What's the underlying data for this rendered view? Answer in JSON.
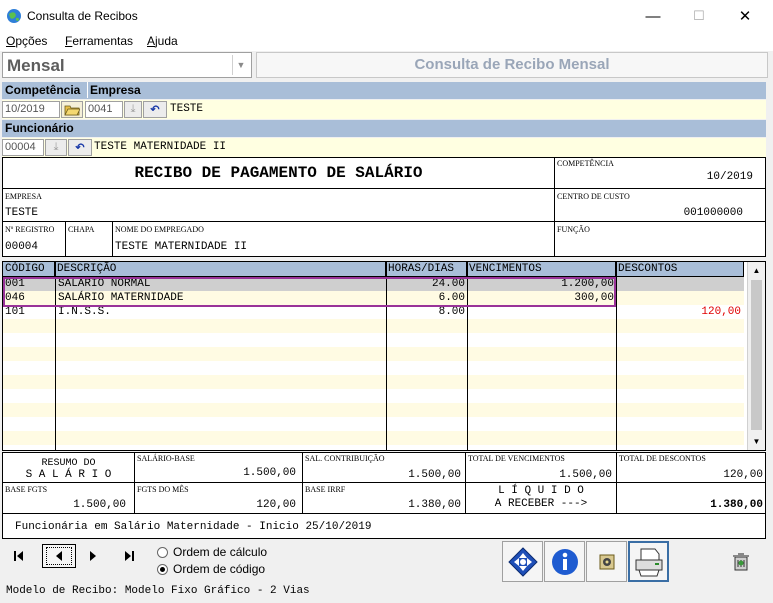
{
  "window": {
    "title": "Consulta de Recibos",
    "min": "—",
    "max": "☐",
    "close": "✕"
  },
  "menu": [
    {
      "label": "Opções",
      "u": "O"
    },
    {
      "label": "Ferramentas",
      "u": "F"
    },
    {
      "label": "Ajuda",
      "u": "A"
    }
  ],
  "combo": {
    "value": "Mensal"
  },
  "header_title": "Consulta de Recibo Mensal",
  "bar1": {
    "competencia": "Competência",
    "empresa": "Empresa"
  },
  "competencia_value": "10/2019",
  "empresa_code": "0041",
  "empresa_name": "TESTE",
  "bar2": {
    "funcionario": "Funcionário"
  },
  "funcionario_code": "00004",
  "funcionario_name": "TESTE MATERNIDADE II",
  "receipt": {
    "title": "RECIBO DE PAGAMENTO DE SALÁRIO",
    "competencia_label": "COMPETÊNCIA",
    "competencia_value": "10/2019",
    "empresa_label": "EMPRESA",
    "empresa_value": "TESTE",
    "centro_label": "CENTRO DE CUSTO",
    "centro_value": "001000000",
    "registro_label": "Nº REGISTRO",
    "registro_value": "00004",
    "chapa_label": "CHAPA",
    "nome_label": "NOME DO EMPREGADO",
    "nome_value": "TESTE MATERNIDADE II",
    "funcao_label": "FUNÇÃO"
  },
  "grid": {
    "headers": [
      "CÓDIGO",
      "DESCRIÇÃO",
      "HORAS/DIAS",
      "VENCIMENTOS",
      "DESCONTOS"
    ],
    "rows": [
      {
        "codigo": "001",
        "descricao": "SALÁRIO NORMAL",
        "horas": "24.00",
        "vencimentos": "1.200,00",
        "descontos": ""
      },
      {
        "codigo": "046",
        "descricao": "SALÁRIO MATERNIDADE",
        "horas": "6.00",
        "vencimentos": "300,00",
        "descontos": ""
      },
      {
        "codigo": "101",
        "descricao": "I.N.S.S.",
        "horas": "8.00",
        "vencimentos": "",
        "descontos": "120,00"
      }
    ]
  },
  "summary": {
    "resumo1": "RESUMO DO",
    "resumo2": "S A L Á R I O",
    "salario_base_label": "SALÁRIO-BASE",
    "salario_base_value": "1.500,00",
    "sal_contrib_label": "SAL. CONTRIBUIÇÃO",
    "sal_contrib_value": "1.500,00",
    "total_venc_label": "TOTAL DE VENCIMENTOS",
    "total_venc_value": "1.500,00",
    "total_desc_label": "TOTAL DE DESCONTOS",
    "total_desc_value": "120,00",
    "base_fgts_label": "BASE FGTS",
    "base_fgts_value": "1.500,00",
    "fgts_mes_label": "FGTS DO MÊS",
    "fgts_mes_value": "120,00",
    "base_irrf_label": "BASE IRRF",
    "base_irrf_value": "1.380,00",
    "liquido1": "L Í Q U I D O",
    "liquido2": "A RECEBER --->",
    "liquido_value": "1.380,00"
  },
  "note": "Funcionária em Salário Maternidade - Inicio 25/10/2019",
  "order": {
    "calc": "Ordem de cálculo",
    "codigo": "Ordem de código"
  },
  "status": "Modelo de Recibo: Modelo Fixo Gráfico - 2 Vias",
  "colors": {
    "accent_blue": "#a9bed8",
    "highlight": "#993399",
    "negative": "#e00000"
  }
}
